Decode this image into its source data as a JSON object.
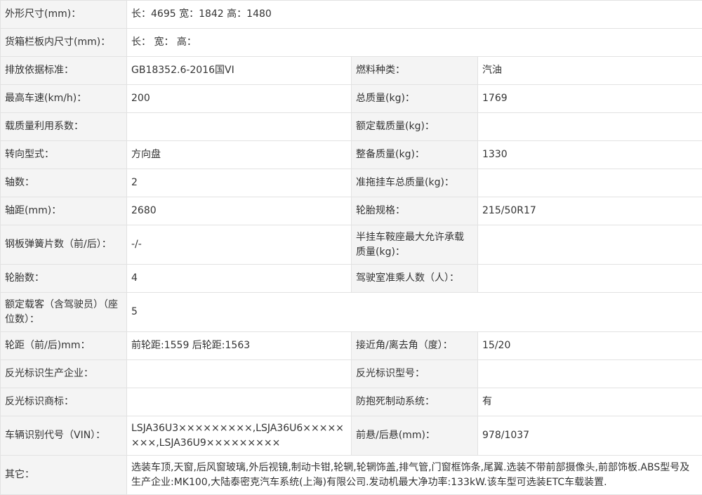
{
  "rows": [
    {
      "l1": "外形尺寸(mm)：",
      "v1": "长：4695 宽：1842 高：1480"
    },
    {
      "l1": "货箱栏板内尺寸(mm)：",
      "v1": "长： 宽： 高："
    },
    {
      "l1": "排放依据标准：",
      "v1": "GB18352.6-2016国VI",
      "l2": "燃料种类：",
      "v2": "汽油"
    },
    {
      "l1": "最高车速(km/h)：",
      "v1": "200",
      "l2": "总质量(kg)：",
      "v2": "1769"
    },
    {
      "l1": "载质量利用系数：",
      "v1": "",
      "l2": "额定载质量(kg)：",
      "v2": ""
    },
    {
      "l1": "转向型式：",
      "v1": "方向盘",
      "l2": "整备质量(kg)：",
      "v2": "1330"
    },
    {
      "l1": "轴数：",
      "v1": "2",
      "l2": "准拖挂车总质量(kg)：",
      "v2": ""
    },
    {
      "l1": "轴距(mm)：",
      "v1": "2680",
      "l2": "轮胎规格：",
      "v2": "215/50R17"
    },
    {
      "l1": "钢板弹簧片数（前/后）：",
      "v1": "-/-",
      "l2": "半挂车鞍座最大允许承载质量(kg)：",
      "v2": ""
    },
    {
      "l1": "轮胎数：",
      "v1": "4",
      "l2": "驾驶室准乘人数（人）：",
      "v2": ""
    },
    {
      "l1": "额定载客（含驾驶员）（座位数）：",
      "v1": "5"
    },
    {
      "l1": "轮距（前/后)mm：",
      "v1": "前轮距:1559 后轮距:1563",
      "l2": "接近角/离去角（度）：",
      "v2": "15/20"
    },
    {
      "l1": "反光标识生产企业：",
      "v1": "",
      "l2": "反光标识型号：",
      "v2": ""
    },
    {
      "l1": "反光标识商标：",
      "v1": "",
      "l2": "防抱死制动系统：",
      "v2": "有"
    },
    {
      "l1": "车辆识别代号（VIN）：",
      "v1": "LSJA36U3×××××××××,LSJA36U6××××××××,LSJA36U9×××××××××",
      "l2": "前悬/后悬(mm)：",
      "v2": "978/1037"
    },
    {
      "l1": "其它：",
      "v1": "选装车顶,天窗,后风窗玻璃,外后视镜,制动卡钳,轮辋,轮辋饰盖,排气管,门窗框饰条,尾翼.选装不带前部摄像头,前部饰板.ABS型号及生产企业:MK100,大陆泰密克汽车系统(上海)有限公司.发动机最大净功率:133kW.该车型可选装ETC车载装置."
    }
  ]
}
